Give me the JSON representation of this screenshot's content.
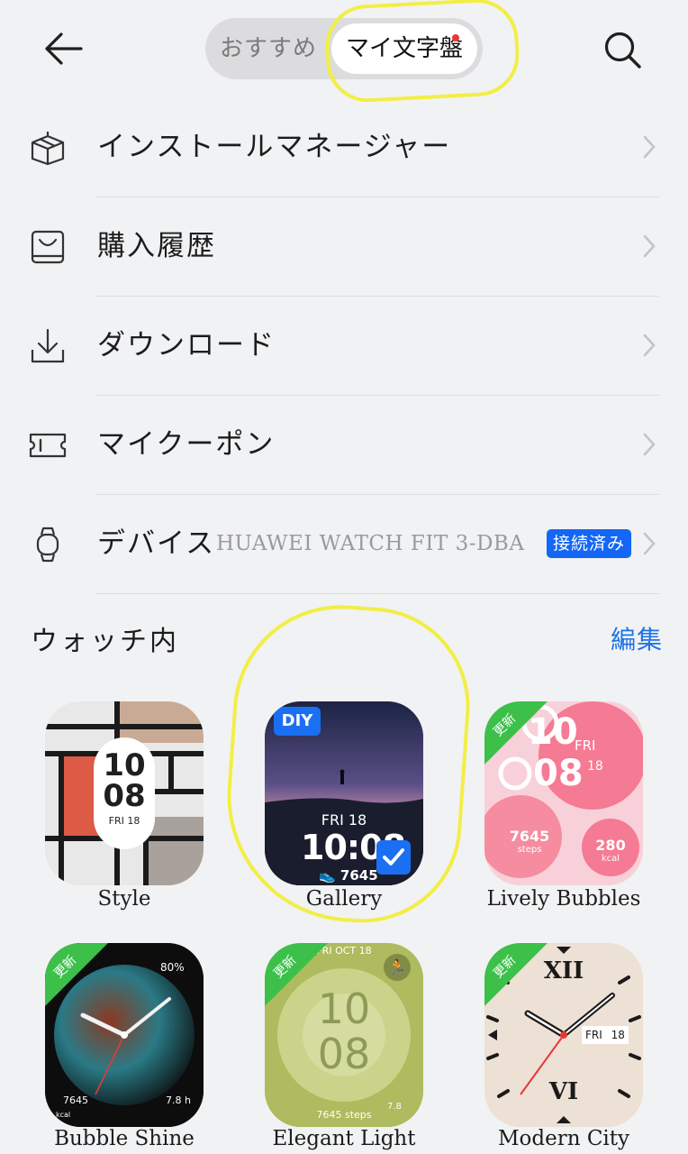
{
  "header": {
    "back_icon": "arrow-left-icon",
    "search_icon": "search-icon",
    "tabs": [
      {
        "label": "おすすめ",
        "active": false
      },
      {
        "label": "マイ文字盤",
        "active": true,
        "has_notification": true
      }
    ]
  },
  "menu": [
    {
      "id": "install",
      "icon": "box-icon",
      "label": "インストールマネージャー"
    },
    {
      "id": "purchase",
      "icon": "purchase-history-icon",
      "label": "購入履歴"
    },
    {
      "id": "download",
      "icon": "download-icon",
      "label": "ダウンロード"
    },
    {
      "id": "coupon",
      "icon": "coupon-icon",
      "label": "マイクーポン"
    },
    {
      "id": "device",
      "icon": "watch-icon",
      "label": "デバイス",
      "model": "HUAWEI WATCH FIT 3-DBA",
      "status": "接続済み"
    }
  ],
  "section": {
    "title": "ウォッチ内",
    "edit_label": "編集"
  },
  "faces": [
    {
      "name": "Style",
      "time_h": "10",
      "time_m": "08",
      "date": "FRI 18",
      "new": false
    },
    {
      "name": "Gallery",
      "badge": "DIY",
      "date": "FRI 18",
      "time": "10:08",
      "steps": "7645",
      "selected": true,
      "new": false
    },
    {
      "name": "Lively Bubbles",
      "new_label": "更新",
      "hour_a": "10",
      "hour_b": "08",
      "day": "FRI",
      "day_num": "18",
      "steps": "7645",
      "steps_unit": "steps",
      "kcal": "280",
      "kcal_unit": "kcal"
    },
    {
      "name": "Bubble Shine",
      "new_label": "更新",
      "battery": "80%",
      "steps": "7645",
      "sleep": "7.8 h",
      "kcal_unit": "kcal"
    },
    {
      "name": "Elegant Light",
      "new_label": "更新",
      "date": "FRI OCT 18",
      "time_h": "10",
      "time_m": "08",
      "steps": "7645 steps",
      "value": "7.8"
    },
    {
      "name": "Modern City",
      "new_label": "更新",
      "num_top": "XII",
      "num_bottom": "VI",
      "day": "FRI",
      "day_num": "18"
    }
  ],
  "colors": {
    "accent": "#1d72e8",
    "badge": "#1467f5",
    "new_badge": "#3cc04a",
    "highlight": "#f2ee45"
  }
}
